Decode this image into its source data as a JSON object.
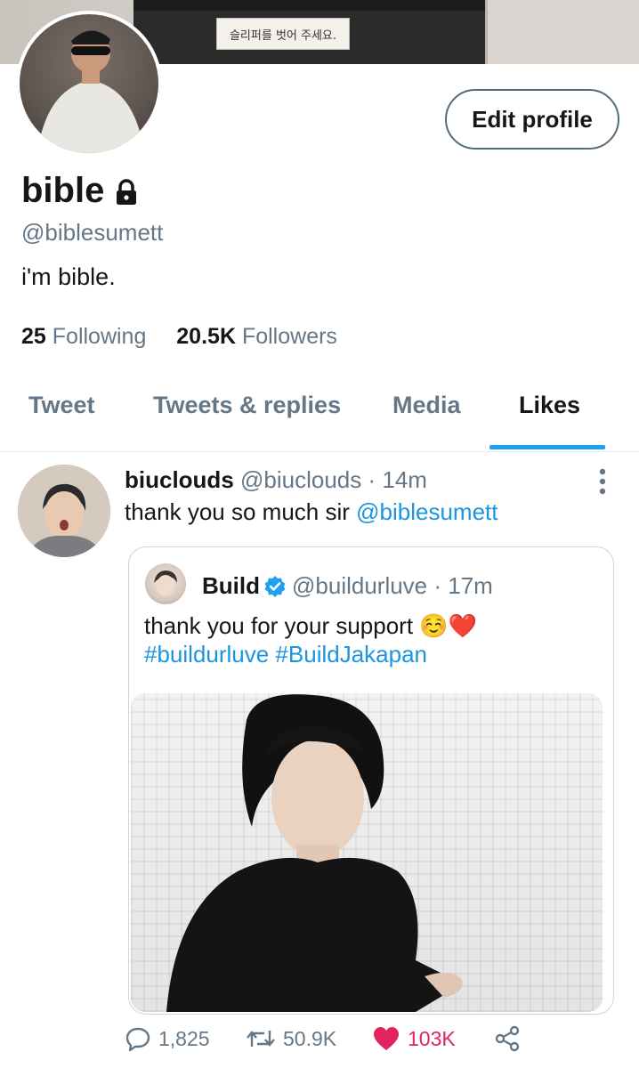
{
  "banner": {
    "sign_text": "슬리퍼를 벗어 주세요."
  },
  "profile": {
    "edit_button_label": "Edit profile",
    "name": "bible",
    "handle": "@biblesumett",
    "bio": "i'm bible.",
    "following_count": "25",
    "following_label": "Following",
    "followers_count": "20.5K",
    "followers_label": "Followers",
    "locked": true
  },
  "tabs": [
    {
      "label": "Tweet",
      "active": false
    },
    {
      "label": "Tweets & replies",
      "active": false
    },
    {
      "label": "Media",
      "active": false
    },
    {
      "label": "Likes",
      "active": true
    }
  ],
  "tweet": {
    "author_name": "biuclouds",
    "author_handle": "@biuclouds",
    "time": "· 14m",
    "text": "thank you so much sir ",
    "mention": "@biblesumett",
    "quoted": {
      "author_name": "Build",
      "verified": true,
      "author_handle": "@buildurluve",
      "time": "· 17m",
      "text": "thank you for your support ☺️❤️",
      "hashtags": "#buildurluve #BuildJakapan"
    },
    "actions": {
      "replies": "1,825",
      "retweets": "50.9K",
      "likes": "103K",
      "liked": true
    }
  },
  "colors": {
    "accent": "#1da1f2",
    "link": "#1b95e0",
    "like": "#e0245e",
    "muted": "#657786"
  }
}
